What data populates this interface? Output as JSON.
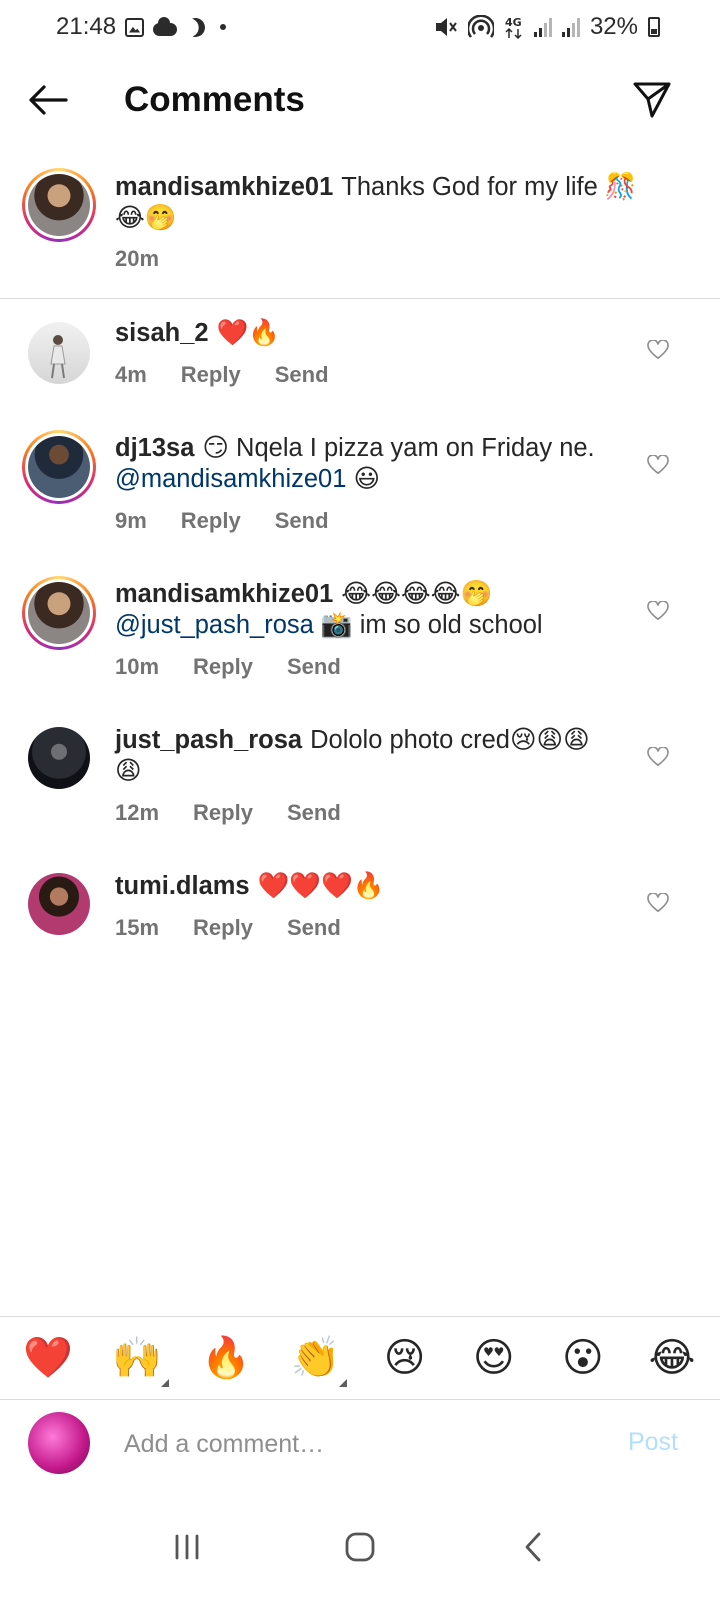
{
  "status_bar": {
    "time": "21:48",
    "battery": "32%",
    "left_icons": [
      "gallery-icon",
      "cloud-icon",
      "do-not-disturb-moon-icon",
      "notification-dot-icon"
    ],
    "right_icons": [
      "mute-icon",
      "hotspot-icon",
      "4g-icon",
      "signal-icon",
      "signal-icon",
      "battery-icon"
    ]
  },
  "header": {
    "title": "Comments",
    "back_icon": "arrow-left-icon",
    "share_icon": "send-icon"
  },
  "caption": {
    "username": "mandisamkhize01",
    "text": "Thanks God for my life 🎊",
    "text_line2": "😂🤭",
    "time": "20m"
  },
  "comments": [
    {
      "username": "sisah_2",
      "text": "❤️🔥",
      "time": "4m",
      "reply_label": "Reply",
      "send_label": "Send"
    },
    {
      "username": "dj13sa",
      "text": "😏 Nqela I pizza yam on Friday ne.",
      "mention": "@mandisamkhize01",
      "text_after_mention": " 😃",
      "time": "9m",
      "reply_label": "Reply",
      "send_label": "Send"
    },
    {
      "username": "mandisamkhize01",
      "text": "😂😂😂😂🤭",
      "mention": "@just_pash_rosa",
      "text_after_mention": " 📸 im so old school",
      "time": "10m",
      "reply_label": "Reply",
      "send_label": "Send"
    },
    {
      "username": "just_pash_rosa",
      "text": "Dololo photo cred😢😩😩",
      "text_line2": "😩",
      "time": "12m",
      "reply_label": "Reply",
      "send_label": "Send"
    },
    {
      "username": "tumi.dlams",
      "text": "❤️❤️❤️🔥",
      "time": "15m",
      "reply_label": "Reply",
      "send_label": "Send"
    }
  ],
  "reactions": [
    "❤️",
    "🙌",
    "🔥",
    "👏",
    "😢",
    "😍",
    "😮",
    "😂"
  ],
  "composer": {
    "placeholder": "Add a comment…",
    "post_label": "Post"
  },
  "nav_bar": {
    "icons": [
      "recent-apps-icon",
      "home-icon",
      "back-icon"
    ]
  },
  "colors": {
    "mention": "#00376b",
    "meta_text": "#737373",
    "post_disabled": "#b2dffc",
    "divider": "#dbdbdb"
  }
}
